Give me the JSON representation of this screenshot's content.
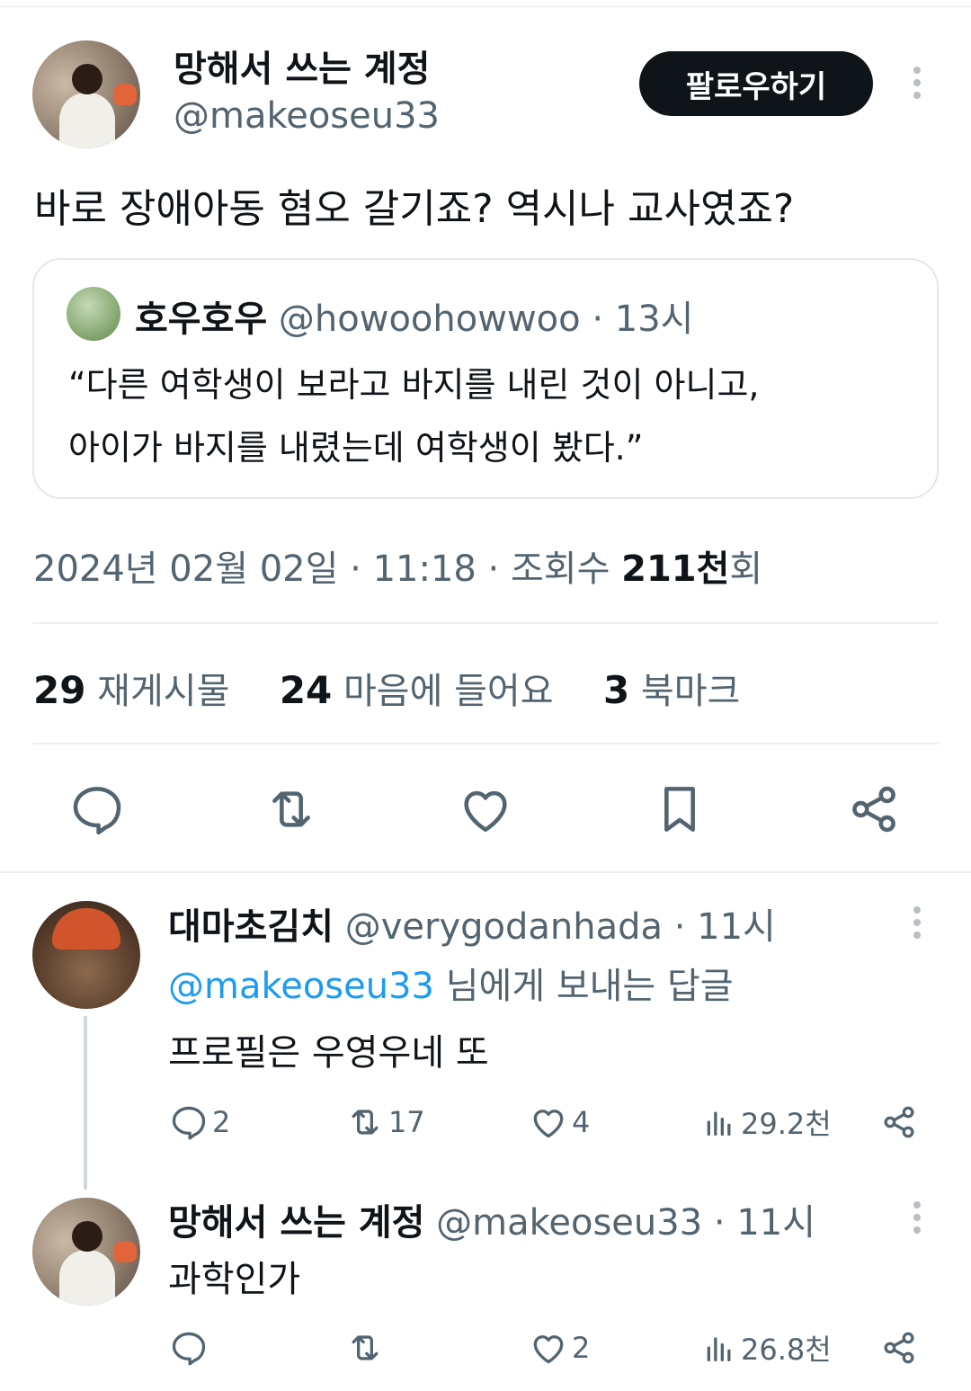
{
  "tweet": {
    "author_name": "망해서 쓰는 계정",
    "author_handle": "@makeoseu33",
    "follow_label": "팔로우하기",
    "text": "바로 장애아동 혐오 갈기죠? 역시나 교사였죠?",
    "quote": {
      "author_name": "호우호우",
      "author_handle": "@howoohowwoo",
      "time": "· 13시",
      "line1": "“다른 여학생이 보라고 바지를 내린 것이 아니고,",
      "line2": "아이가 바지를 내렸는데 여학생이 봤다.”"
    },
    "meta_date": "2024년 02월 02일 · 11:18 · 조회수 ",
    "meta_views": "211천",
    "meta_suffix": "회",
    "stats": {
      "reposts_count": "29",
      "reposts_label": "재게시물",
      "likes_count": "24",
      "likes_label": "마음에 들어요",
      "bookmarks_count": "3",
      "bookmarks_label": "북마크"
    },
    "actions": [
      "reply-icon",
      "repost-icon",
      "like-icon",
      "bookmark-icon",
      "share-icon"
    ]
  },
  "replies": [
    {
      "author_name": "대마초김치",
      "author_handle": "@verygodanhada",
      "time": "· 11시",
      "mention": "@makeoseu33",
      "mention_suffix": " 님에게 보내는 답글",
      "text": "프로필은 우영우네 또",
      "reply_count": "2",
      "repost_count": "17",
      "like_count": "4",
      "view_count": "29.2천"
    },
    {
      "author_name": "망해서 쓰는 계정",
      "author_handle": "@makeoseu33",
      "time": "· 11시",
      "text": "과학인가",
      "reply_count": "",
      "repost_count": "",
      "like_count": "2",
      "view_count": "26.8천"
    }
  ],
  "colors": {
    "text": "#0f1419",
    "secondary": "#536471",
    "accent": "#1d9bf0",
    "follow_bg": "#0f1419",
    "border": "#e3e7ea"
  }
}
